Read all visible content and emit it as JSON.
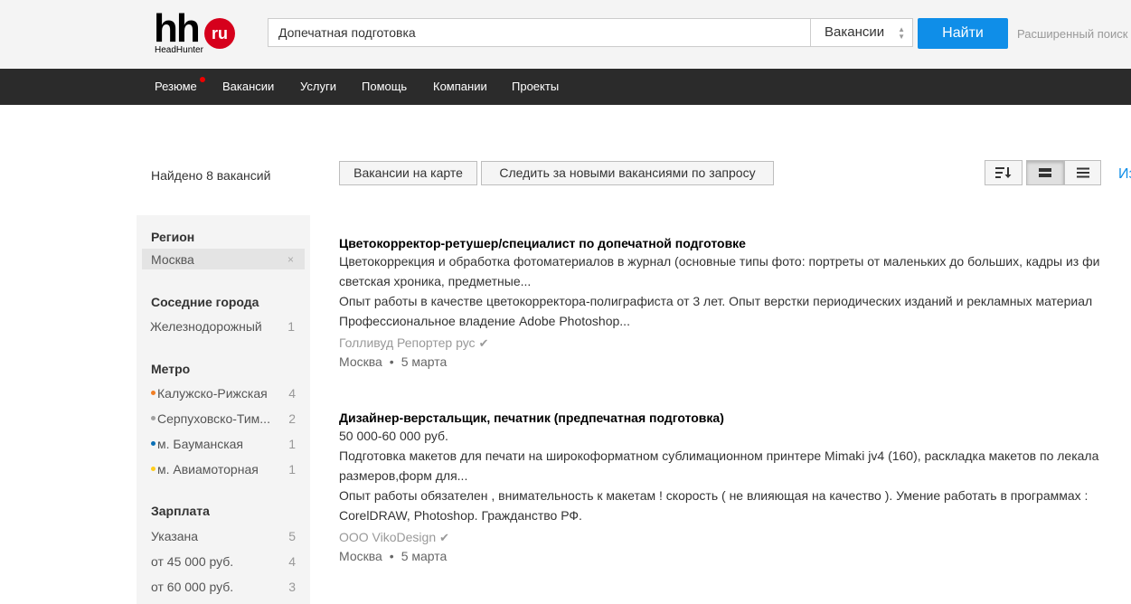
{
  "header": {
    "logo_main": "hh",
    "logo_badge": "ru",
    "logo_sub": "HeadHunter",
    "search_value": "Допечатная подготовка",
    "search_type": "Вакансии",
    "find_label": "Найти",
    "advanced_label": "Расширенный поиск"
  },
  "nav": {
    "items": [
      "Резюме",
      "Вакансии",
      "Услуги",
      "Помощь",
      "Компании",
      "Проекты"
    ]
  },
  "toolbar": {
    "found_text": "Найдено 8 вакансий",
    "map_label": "Вакансии на карте",
    "follow_label": "Следить за новыми вакансиями по запросу",
    "edge_text": "Из"
  },
  "sidebar": {
    "region": {
      "title": "Регион",
      "selected": "Москва",
      "remove": "×"
    },
    "neighbors": {
      "title": "Соседние города",
      "items": [
        {
          "label": "Железнодорожный",
          "count": "1"
        }
      ]
    },
    "metro": {
      "title": "Метро",
      "items": [
        {
          "label": "Калужско-Рижская",
          "count": "4",
          "color": "#f07e24"
        },
        {
          "label": "Серпуховско-Тим...",
          "count": "2",
          "color": "#a0a0a0"
        },
        {
          "label": "м. Бауманская",
          "count": "1",
          "color": "#0a6fb5"
        },
        {
          "label": "м. Авиамоторная",
          "count": "1",
          "color": "#ffcd1c"
        }
      ]
    },
    "salary": {
      "title": "Зарплата",
      "items": [
        {
          "label": "Указана",
          "count": "5"
        },
        {
          "label": "от 45 000 руб.",
          "count": "4"
        },
        {
          "label": "от 60 000 руб.",
          "count": "3"
        }
      ]
    }
  },
  "vacancies": [
    {
      "title": "Цветокорректор-ретушер/специалист по допечатной подготовке",
      "lines": [
        "Цветокоррекция и обработка фотоматериалов в журнал (основные типы фото: портреты от маленьких до больших, кадры из фи",
        "светская хроника, предметные...",
        "Опыт работы в качестве цветокорректора-полиграфиста от 3 лет. Опыт верстки периодических изданий и рекламных материал",
        "Профессиональное владение Adobe Photoshop..."
      ],
      "company": "Голливуд Репортер рус",
      "check": "✔",
      "city": "Москва",
      "date": "5 марта"
    },
    {
      "title": "Дизайнер-верстальщик, печатник (предпечатная подготовка)",
      "lines": [
        "50 000-60 000 руб.",
        "Подготовка макетов для печати на широкоформатном сублимационном принтере Mimaki jv4 (160), раскладка макетов по лекала",
        "размеров,форм для...",
        "Опыт работы обязателен , внимательность к макетам ! скорость ( не влияющая на качество ). Умение работать в программах :",
        "CorelDRAW, Photoshop. Гражданство РФ."
      ],
      "company": "ООО VikoDesign",
      "check": "✔",
      "city": "Москва",
      "date": "5 марта"
    }
  ]
}
